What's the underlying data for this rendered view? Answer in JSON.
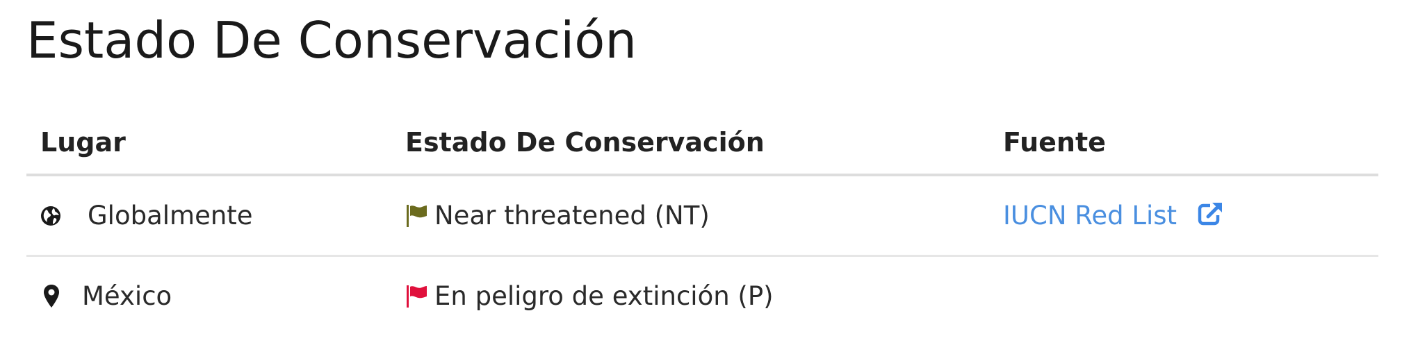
{
  "page": {
    "title": "Estado De Conservación"
  },
  "table": {
    "headers": {
      "place": "Lugar",
      "status": "Estado De Conservación",
      "source": "Fuente"
    },
    "rows": [
      {
        "place": "Globalmente",
        "place_icon": "globe-icon",
        "status": "Near threatened (NT)",
        "status_icon": "flag-icon",
        "status_color": "#6b6b1e",
        "source": "IUCN Red List",
        "source_icon": "external-link-icon"
      },
      {
        "place": "México",
        "place_icon": "map-pin-icon",
        "status": "En peligro de extinción (P)",
        "status_icon": "flag-icon",
        "status_color": "#e0103c",
        "source": ""
      }
    ]
  },
  "colors": {
    "link": "#4a8fe0",
    "divider": "#dddddd",
    "text": "#222222"
  }
}
